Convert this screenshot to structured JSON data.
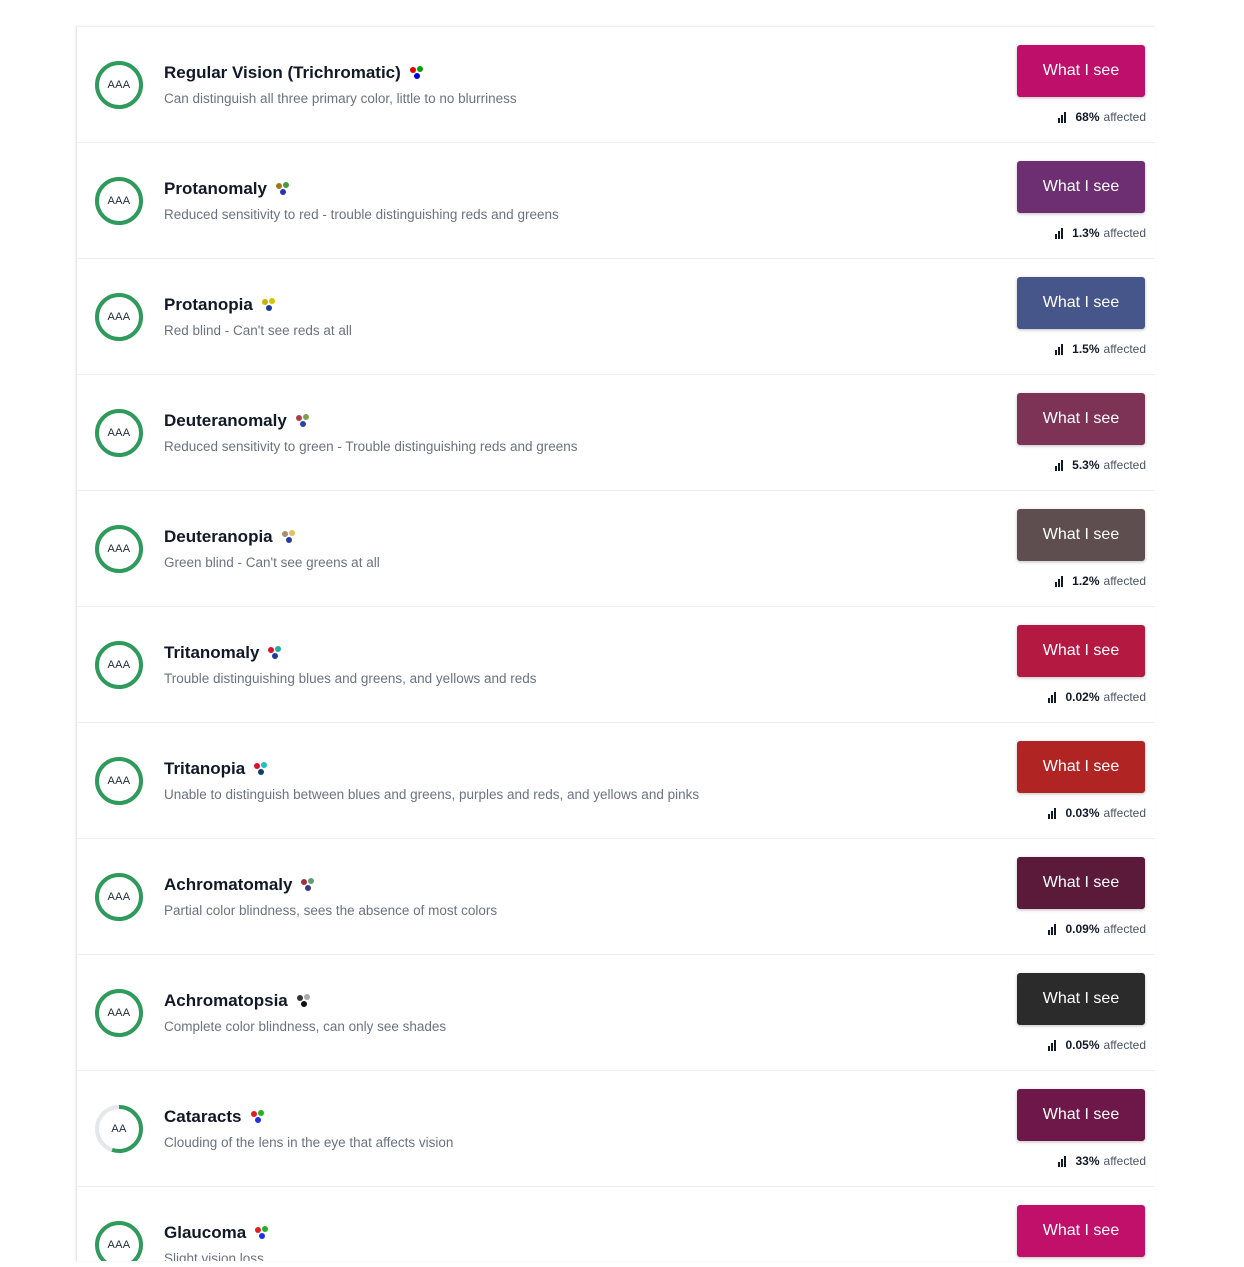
{
  "affected_label": "affected",
  "button_label": "What I see",
  "rows": [
    {
      "rating": "AAA",
      "score": 1.0,
      "name": "Regular Vision (Trichromatic)",
      "description": "Can distinguish all three primary color, little to no blurriness",
      "percent": "68%",
      "button_color": "#be0f6b",
      "dot_colors": [
        "#e00000",
        "#00a000",
        "#0000e0"
      ]
    },
    {
      "rating": "AAA",
      "score": 1.0,
      "name": "Protanomaly",
      "description": "Reduced sensitivity to red - trouble distinguishing reds and greens",
      "percent": "1.3%",
      "button_color": "#6e2f72",
      "dot_colors": [
        "#a07a10",
        "#4a9a40",
        "#2a30c0"
      ]
    },
    {
      "rating": "AAA",
      "score": 1.0,
      "name": "Protanopia",
      "description": "Red blind - Can't see reds at all",
      "percent": "1.5%",
      "button_color": "#47568a",
      "dot_colors": [
        "#c8b400",
        "#d8c400",
        "#1d3a9a"
      ]
    },
    {
      "rating": "AAA",
      "score": 1.0,
      "name": "Deuteranomaly",
      "description": "Reduced sensitivity to green - Trouble distinguishing reds and greens",
      "percent": "5.3%",
      "button_color": "#7d3356",
      "dot_colors": [
        "#b04040",
        "#7aa050",
        "#2a40b0"
      ]
    },
    {
      "rating": "AAA",
      "score": 1.0,
      "name": "Deuteranopia",
      "description": "Green blind - Can't see greens at all",
      "percent": "1.2%",
      "button_color": "#5e4e4f",
      "dot_colors": [
        "#a89070",
        "#e0c060",
        "#2a3aa0"
      ]
    },
    {
      "rating": "AAA",
      "score": 1.0,
      "name": "Tritanomaly",
      "description": "Trouble distinguishing blues and greens, and yellows and reds",
      "percent": "0.02%",
      "button_color": "#b31941",
      "dot_colors": [
        "#e0102a",
        "#20b0a0",
        "#203aa0"
      ]
    },
    {
      "rating": "AAA",
      "score": 1.0,
      "name": "Tritanopia",
      "description": "Unable to distinguish between blues and greens, purples and reds, and yellows and pinks",
      "percent": "0.03%",
      "button_color": "#b12424",
      "dot_colors": [
        "#e0102a",
        "#20c0c0",
        "#104060"
      ]
    },
    {
      "rating": "AAA",
      "score": 1.0,
      "name": "Achromatomaly",
      "description": "Partial color blindness, sees the absence of most colors",
      "percent": "0.09%",
      "button_color": "#5c1a3b",
      "dot_colors": [
        "#a03040",
        "#60a070",
        "#3a3a80"
      ]
    },
    {
      "rating": "AAA",
      "score": 1.0,
      "name": "Achromatopsia",
      "description": "Complete color blindness, can only see shades",
      "percent": "0.05%",
      "button_color": "#2b2b2b",
      "dot_colors": [
        "#333333",
        "#aaaaaa",
        "#111111"
      ]
    },
    {
      "rating": "AA",
      "score": 0.55,
      "name": "Cataracts",
      "description": "Clouding of the lens in the eye that affects vision",
      "percent": "33%",
      "button_color": "#6d1848",
      "dot_colors": [
        "#e02020",
        "#20b020",
        "#2030e0"
      ]
    },
    {
      "rating": "AAA",
      "score": 1.0,
      "name": "Glaucoma",
      "description": "Slight vision loss",
      "percent": "",
      "button_color": "#c0106a",
      "dot_colors": [
        "#e02020",
        "#20b020",
        "#2030e0"
      ]
    }
  ]
}
